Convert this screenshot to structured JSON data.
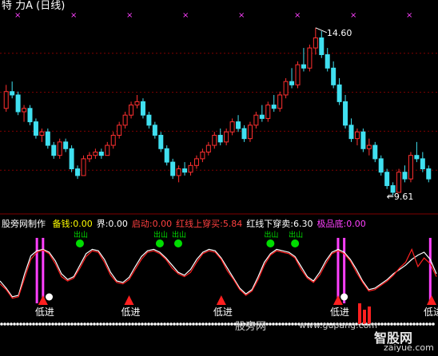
{
  "title": "特  力A (日线)",
  "indicator": {
    "name": "股旁网制作",
    "items": [
      {
        "label": "备钱:",
        "value": "0.00",
        "color": "#ffff00"
      },
      {
        "label": "界:",
        "value": "0.00",
        "color": "#ffffff"
      },
      {
        "label": "启动:",
        "value": "0.00",
        "color": "#ff4040"
      },
      {
        "label": "红线上穿买:",
        "value": "5.84",
        "color": "#ff4040"
      },
      {
        "label": "红线下穿卖:",
        "value": "6.30",
        "color": "#ffffff"
      },
      {
        "label": "极品底:",
        "value": "0.00",
        "color": "#ff40ff"
      }
    ],
    "signal_text": "低进",
    "green_dot_text": "出山"
  },
  "colors": {
    "up": "#ff3030",
    "down": "#40e0f0",
    "grid": "#800000",
    "pink": "#ff40ff",
    "green": "#00dd00",
    "white_line": "#ffffff",
    "red_line": "#ff2020"
  },
  "watermark": {
    "text1": "股旁网",
    "text2": "www.gupang.com",
    "text3": "智股网",
    "text4": "zaiyue.com"
  },
  "chart_data": [
    {
      "type": "candlestick",
      "title": "特  力A (日线)",
      "annotations": [
        {
          "label": "14.60",
          "type": "high"
        },
        {
          "label": "9.61",
          "type": "low"
        }
      ],
      "ylim": [
        9.2,
        15.0
      ],
      "candles": [
        [
          12.2,
          12.9,
          12.1,
          12.7
        ],
        [
          12.7,
          13.0,
          12.5,
          12.6
        ],
        [
          12.6,
          12.7,
          12.0,
          12.1
        ],
        [
          12.1,
          12.3,
          11.8,
          12.2
        ],
        [
          12.2,
          12.3,
          11.7,
          11.8
        ],
        [
          11.8,
          11.9,
          11.3,
          11.4
        ],
        [
          11.4,
          11.6,
          11.2,
          11.5
        ],
        [
          11.5,
          11.6,
          11.0,
          11.1
        ],
        [
          11.1,
          11.2,
          10.7,
          10.8
        ],
        [
          10.8,
          11.3,
          10.7,
          11.2
        ],
        [
          11.2,
          11.3,
          10.9,
          11.0
        ],
        [
          11.0,
          11.1,
          10.3,
          10.4
        ],
        [
          10.4,
          10.5,
          10.1,
          10.2
        ],
        [
          10.2,
          10.8,
          10.2,
          10.7
        ],
        [
          10.7,
          10.9,
          10.6,
          10.8
        ],
        [
          10.8,
          11.0,
          10.7,
          10.9
        ],
        [
          10.9,
          11.0,
          10.7,
          10.8
        ],
        [
          10.8,
          11.2,
          10.8,
          11.1
        ],
        [
          11.1,
          11.5,
          11.0,
          11.4
        ],
        [
          11.4,
          11.8,
          11.3,
          11.7
        ],
        [
          11.7,
          12.1,
          11.6,
          12.0
        ],
        [
          12.0,
          12.4,
          11.9,
          12.3
        ],
        [
          12.3,
          12.6,
          12.2,
          12.4
        ],
        [
          12.4,
          12.5,
          11.9,
          12.0
        ],
        [
          12.0,
          12.1,
          11.6,
          11.7
        ],
        [
          11.7,
          11.8,
          11.3,
          11.4
        ],
        [
          11.4,
          11.5,
          10.9,
          11.0
        ],
        [
          11.0,
          11.1,
          10.5,
          10.6
        ],
        [
          10.6,
          10.7,
          10.1,
          10.2
        ],
        [
          10.2,
          10.5,
          10.0,
          10.4
        ],
        [
          10.4,
          10.6,
          10.2,
          10.3
        ],
        [
          10.3,
          10.6,
          10.2,
          10.5
        ],
        [
          10.5,
          10.8,
          10.4,
          10.7
        ],
        [
          10.7,
          11.0,
          10.6,
          10.9
        ],
        [
          10.9,
          11.2,
          10.8,
          11.1
        ],
        [
          11.1,
          11.5,
          11.0,
          11.4
        ],
        [
          11.4,
          11.6,
          11.1,
          11.2
        ],
        [
          11.2,
          11.6,
          11.1,
          11.5
        ],
        [
          11.5,
          11.9,
          11.4,
          11.8
        ],
        [
          11.8,
          12.0,
          11.5,
          11.6
        ],
        [
          11.6,
          11.7,
          11.2,
          11.3
        ],
        [
          11.3,
          11.8,
          11.2,
          11.7
        ],
        [
          11.7,
          12.1,
          11.6,
          12.0
        ],
        [
          12.0,
          12.3,
          11.8,
          11.9
        ],
        [
          11.9,
          12.4,
          11.8,
          12.3
        ],
        [
          12.3,
          12.6,
          12.1,
          12.2
        ],
        [
          12.2,
          12.7,
          12.1,
          12.6
        ],
        [
          12.6,
          13.1,
          12.5,
          13.0
        ],
        [
          13.0,
          13.4,
          12.8,
          12.9
        ],
        [
          12.9,
          13.6,
          12.8,
          13.5
        ],
        [
          13.5,
          14.0,
          13.3,
          13.4
        ],
        [
          13.4,
          14.1,
          13.3,
          14.0
        ],
        [
          14.0,
          14.6,
          13.8,
          14.3
        ],
        [
          14.3,
          14.5,
          13.7,
          13.8
        ],
        [
          13.8,
          14.0,
          13.3,
          13.4
        ],
        [
          13.4,
          13.6,
          12.8,
          12.9
        ],
        [
          12.9,
          13.1,
          12.3,
          12.4
        ],
        [
          12.4,
          12.6,
          11.6,
          11.7
        ],
        [
          11.7,
          11.9,
          11.2,
          11.3
        ],
        [
          11.3,
          11.6,
          11.1,
          11.5
        ],
        [
          11.5,
          11.6,
          10.9,
          11.0
        ],
        [
          11.0,
          11.3,
          10.8,
          11.1
        ],
        [
          11.1,
          11.2,
          10.6,
          10.7
        ],
        [
          10.7,
          10.8,
          10.2,
          10.3
        ],
        [
          10.3,
          10.4,
          9.8,
          9.9
        ],
        [
          9.9,
          10.0,
          9.61,
          9.7
        ],
        [
          9.7,
          10.4,
          9.7,
          10.3
        ],
        [
          10.3,
          10.5,
          10.0,
          10.1
        ],
        [
          10.1,
          10.9,
          10.0,
          10.8
        ],
        [
          10.8,
          11.2,
          10.6,
          10.7
        ],
        [
          10.7,
          10.9,
          10.3,
          10.4
        ],
        [
          10.4,
          10.5,
          10.0,
          10.1
        ]
      ]
    },
    {
      "type": "line",
      "title": "股旁网制作",
      "ylim": [
        0,
        100
      ],
      "series": [
        {
          "name": "",
          "values": [
            40,
            30,
            18,
            20,
            50,
            75,
            82,
            84,
            80,
            68,
            50,
            42,
            46,
            62,
            78,
            84,
            82,
            70,
            52,
            40,
            38,
            45,
            60,
            74,
            82,
            84,
            80,
            72,
            62,
            52,
            48,
            56,
            70,
            80,
            84,
            82,
            72,
            58,
            44,
            30,
            22,
            28,
            46,
            66,
            78,
            84,
            82,
            80,
            74,
            60,
            46,
            40,
            52,
            68,
            80,
            84,
            80,
            70,
            56,
            40,
            28,
            30,
            36,
            42,
            50,
            56,
            62,
            70,
            76,
            80,
            70,
            50
          ]
        },
        {
          "name": "",
          "values": [
            36,
            28,
            16,
            18,
            44,
            70,
            80,
            83,
            78,
            64,
            46,
            40,
            44,
            58,
            74,
            82,
            80,
            66,
            48,
            38,
            36,
            42,
            56,
            70,
            80,
            82,
            78,
            70,
            58,
            50,
            46,
            52,
            66,
            78,
            82,
            80,
            70,
            54,
            42,
            28,
            20,
            26,
            42,
            62,
            76,
            82,
            80,
            78,
            72,
            56,
            44,
            38,
            48,
            64,
            78,
            82,
            78,
            68,
            52,
            38,
            26,
            28,
            34,
            40,
            48,
            58,
            66,
            84,
            60,
            72,
            64,
            46
          ]
        }
      ],
      "signals": [
        "低进",
        "低进",
        "低进",
        "低进",
        "低进",
        "低进"
      ]
    }
  ]
}
